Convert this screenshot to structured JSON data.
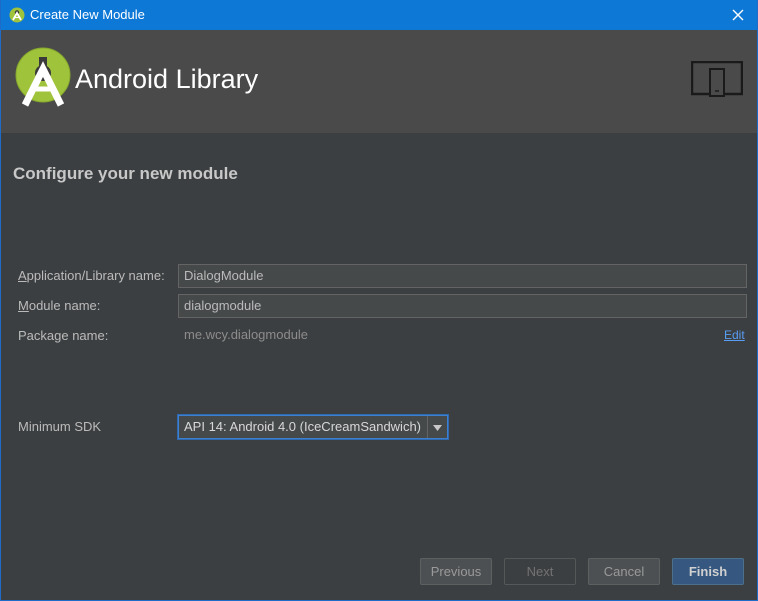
{
  "window": {
    "title": "Create New Module"
  },
  "header": {
    "title": "Android Library",
    "logo_icon": "android-studio-logo",
    "device_icon": "phone-tablet-icon"
  },
  "section": {
    "title": "Configure your new module"
  },
  "form": {
    "app_name": {
      "label_accel": "A",
      "label_rest": "pplication/Library name:",
      "value": "DialogModule"
    },
    "module_name": {
      "label_accel": "M",
      "label_rest": "odule name:",
      "value": "dialogmodule"
    },
    "package_name": {
      "label": "Package name:",
      "value": "me.wcy.dialogmodule",
      "edit_label": "Edit"
    },
    "min_sdk": {
      "label": "Minimum SDK",
      "selected": "API 14: Android 4.0 (IceCreamSandwich)"
    }
  },
  "buttons": {
    "previous": "Previous",
    "next": "Next",
    "cancel": "Cancel",
    "finish": "Finish"
  },
  "colors": {
    "titlebar": "#0e78d7",
    "header": "#4a4a4a",
    "body": "#3c3f41",
    "link": "#589df6",
    "logo_green": "#9fc33a"
  }
}
